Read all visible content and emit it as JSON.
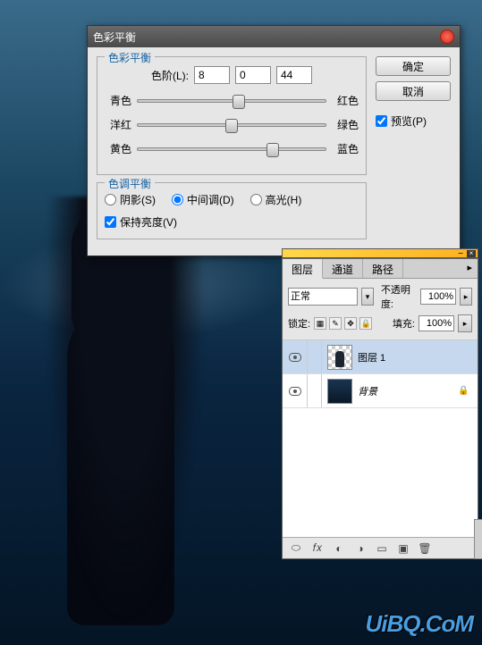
{
  "background": {
    "watermark": "UiBQ.CoM"
  },
  "colorBalance": {
    "title": "色彩平衡",
    "group1_legend": "色彩平衡",
    "levels_label": "色阶(L):",
    "levels": [
      "8",
      "0",
      "44"
    ],
    "sliders": [
      {
        "left": "青色",
        "right": "红色",
        "pos": 54
      },
      {
        "left": "洋红",
        "right": "绿色",
        "pos": 50
      },
      {
        "left": "黄色",
        "right": "蓝色",
        "pos": 72
      }
    ],
    "group2_legend": "色调平衡",
    "tones": [
      {
        "label": "阴影(S)",
        "value": "shadows",
        "checked": false
      },
      {
        "label": "中间调(D)",
        "value": "midtones",
        "checked": true
      },
      {
        "label": "高光(H)",
        "value": "highlights",
        "checked": false
      }
    ],
    "preserve_label": "保持亮度(V)",
    "preserve_checked": true,
    "ok": "确定",
    "cancel": "取消",
    "preview_label": "预览(P)",
    "preview_checked": true
  },
  "layersPanel": {
    "tabs": [
      "图层",
      "通道",
      "路径"
    ],
    "activeTab": 0,
    "blendModeLabel": "正常",
    "opacityLabel": "不透明度:",
    "opacityValue": "100%",
    "lockLabel": "锁定:",
    "fillLabel": "填充:",
    "fillValue": "100%",
    "layers": [
      {
        "name": "图层 1",
        "visible": true,
        "selected": true,
        "thumb": "checker",
        "locked": false
      },
      {
        "name": "背景",
        "visible": true,
        "selected": false,
        "thumb": "bg",
        "locked": true,
        "italic": true
      }
    ]
  }
}
